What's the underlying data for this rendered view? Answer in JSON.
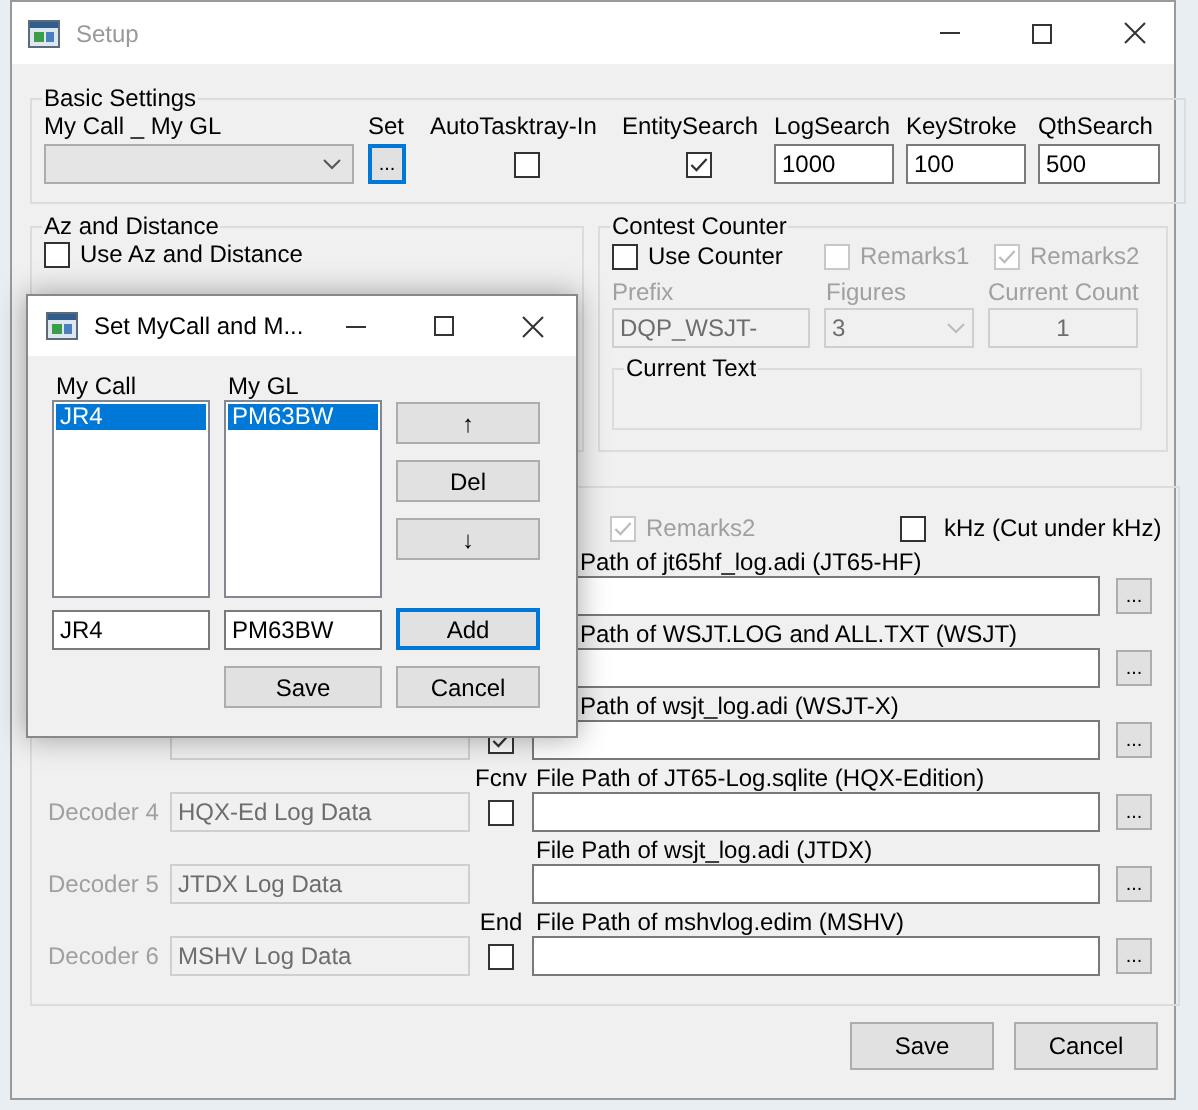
{
  "window": {
    "title": "Setup"
  },
  "basic_settings": {
    "title": "Basic Settings",
    "call_label": "My Call _ My GL",
    "set_label": "Set",
    "set_button": {
      "label": "...",
      "focused": true
    },
    "autotasktray": {
      "label": "AutoTasktray-In",
      "checked": false
    },
    "entity_search": {
      "label": "EntitySearch",
      "checked": true
    },
    "fields": [
      {
        "label": "LogSearch",
        "value": "1000"
      },
      {
        "label": "KeyStroke",
        "value": "100"
      },
      {
        "label": "QthSearch",
        "value": "500"
      }
    ]
  },
  "az_distance": {
    "title": "Az and Distance",
    "use": {
      "label": "Use Az and Distance",
      "checked": false
    }
  },
  "contest_counter": {
    "title": "Contest Counter",
    "checks": [
      {
        "label": "Use Counter",
        "checked": false,
        "disabled": false
      },
      {
        "label": "Remarks1",
        "checked": false,
        "disabled": true
      },
      {
        "label": "Remarks2",
        "checked": true,
        "disabled": true
      }
    ],
    "prefix": {
      "label": "Prefix",
      "value": "DQP_WSJT-"
    },
    "figures": {
      "label": "Figures",
      "value": "3"
    },
    "current_count": {
      "label": "Current Count",
      "value": "1"
    },
    "current_text": {
      "title": "Current Text"
    }
  },
  "decoders": {
    "remarks2": {
      "label": "Remarks2",
      "checked": true,
      "disabled": true
    },
    "khz": {
      "label": "kHz (Cut under kHz)",
      "checked": false
    },
    "rows": [
      {
        "path_label": "Path of jt65hf_log.adi (JT65-HF)",
        "browse": "..."
      },
      {
        "path_label": "Path of WSJT.LOG and ALL.TXT (WSJT)",
        "browse": "..."
      },
      {
        "name_field": true,
        "checked": true,
        "path_label": "Path of wsjt_log.adi (WSJT-X)",
        "browse": "..."
      },
      {
        "decoder": "Decoder 4",
        "name": "HQX-Ed Log Data",
        "check_label": "Fcnv",
        "checked": false,
        "path_label": "File Path of JT65-Log.sqlite (HQX-Edition)",
        "browse": "..."
      },
      {
        "decoder": "Decoder 5",
        "name": "JTDX Log Data",
        "path_label": "File Path of wsjt_log.adi (JTDX)",
        "browse": "..."
      },
      {
        "decoder": "Decoder 6",
        "name": "MSHV Log Data",
        "check_label": "End",
        "checked": false,
        "path_label": "File Path of mshvlog.edim (MSHV)",
        "browse": "..."
      }
    ]
  },
  "buttons": [
    "Save",
    "Cancel"
  ],
  "dialog": {
    "title": "Set MyCall and M...",
    "call_label": "My Call",
    "gl_label": "My GL",
    "calls": [
      {
        "text": "JR4",
        "selected": true
      }
    ],
    "gls": [
      {
        "text": "PM63BW",
        "selected": true
      }
    ],
    "side_buttons": [
      "↑",
      "Del",
      "↓"
    ],
    "call_value": "JR4",
    "gl_value": "PM63BW",
    "add_button": {
      "label": "Add",
      "focused": true
    },
    "save_button": "Save",
    "cancel_button": "Cancel"
  }
}
